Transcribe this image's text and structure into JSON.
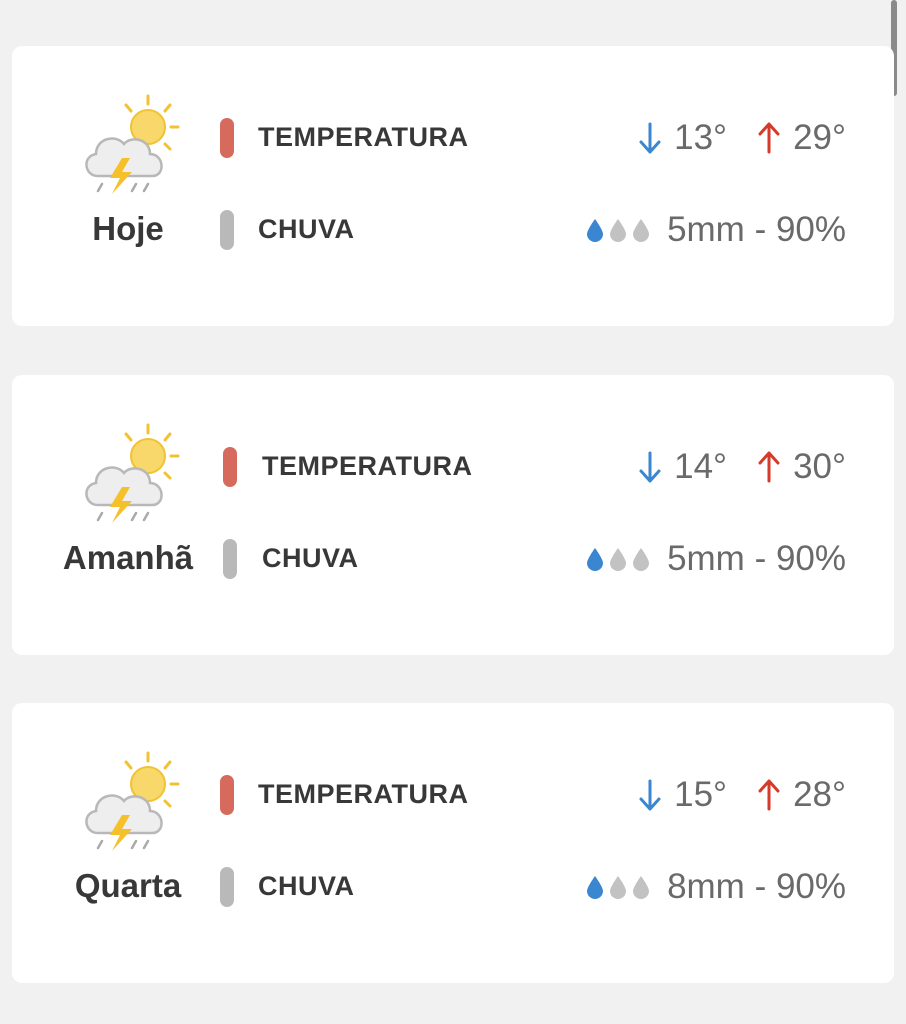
{
  "colors": {
    "background": "#f1f1f1",
    "card": "#ffffff",
    "temperature_pill": "#d56a5d",
    "rain_pill": "#b9b9b9",
    "arrow_min": "#3b86d0",
    "arrow_max": "#d63a2a",
    "drop_filled": "#3b86d0",
    "drop_empty": "#c2c2c2",
    "text_dark": "#383838",
    "text_value": "#6a6a6a"
  },
  "days": [
    {
      "day": "Hoje",
      "icon": "sun-cloud-thunderstorm-icon",
      "temperature_label": "TEMPERATURA",
      "min": "13°",
      "max": "29°",
      "rain_label": "CHUVA",
      "rain_text": "5mm - 90%",
      "rain_drops_filled": 1,
      "rain_drops_total": 3
    },
    {
      "day": "Amanhã",
      "icon": "sun-cloud-thunderstorm-icon",
      "temperature_label": "TEMPERATURA",
      "min": "14°",
      "max": "30°",
      "rain_label": "CHUVA",
      "rain_text": "5mm - 90%",
      "rain_drops_filled": 1,
      "rain_drops_total": 3
    },
    {
      "day": "Quarta",
      "icon": "sun-cloud-thunderstorm-icon",
      "temperature_label": "TEMPERATURA",
      "min": "15°",
      "max": "28°",
      "rain_label": "CHUVA",
      "rain_text": "8mm - 90%",
      "rain_drops_filled": 1,
      "rain_drops_total": 3
    }
  ]
}
